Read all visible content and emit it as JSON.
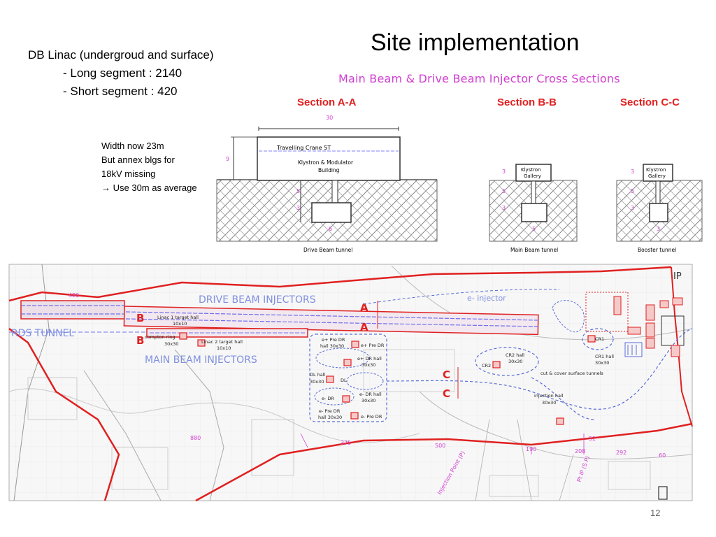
{
  "title": "Site implementation",
  "db_linac": {
    "heading": "DB Linac (undergroud and surface)",
    "long": "- Long segment : 2140",
    "short": "- Short segment :  420"
  },
  "note": {
    "line1": "Width now 23m",
    "line2": "But annex blgs for",
    "line3": "18kV missing",
    "line4": "→ Use 30m as average"
  },
  "cross_section": {
    "title": "Main Beam & Drive Beam Injector Cross Sections",
    "section_a": "Section A-A",
    "section_b": "Section B-B",
    "section_c": "Section C-C",
    "crane": "Travelling Crane 5T",
    "klystron_mod": "Klystron & Modulator",
    "building": "Building",
    "klystron_gallery_1": "Klystron",
    "klystron_gallery_2": "Gallery",
    "width_30": "30",
    "height_9": "9",
    "dim_3": "3",
    "dim_5": "5",
    "dim_6": "6",
    "dim_5b": "5",
    "dim_3b": "3",
    "drive_tunnel": "Drive Beam tunnel",
    "main_tunnel": "Main Beam tunnel",
    "booster_tunnel": "Booster tunnel"
  },
  "map": {
    "drive_beam_injectors": "DRIVE BEAM INJECTORS",
    "main_beam_injectors": "MAIN BEAM INJECTORS",
    "ds_tunnel": "RDS TUNNEL",
    "e_injector": "e- injector",
    "linac1": "Linac 1 target hall",
    "linac1_size": "10x10",
    "linac2": "Linac 2 target hall",
    "linac2_size": "10x10",
    "compton": "compton ring",
    "compton_size": "30x30",
    "pre_dr_hall": "e+ Pre DR",
    "pre_dr_hall_size": "hall 30x30",
    "e_pre_dr": "e+ Pre DR",
    "dr_hall": "e+ DR hall",
    "dr_hall_size": "30x30",
    "dl_hall": "DL hall",
    "dl_size": "30x30",
    "dl_short": "DL",
    "e_dr": "e- DR",
    "e_dr_hall": "e- DR hall",
    "e_dr_hall_size": "30x30",
    "e_pre_dr2": "e- Pre DR",
    "e_pre_dr2_size": "hall 30x30",
    "e_pre_dr3": "e- Pre DR",
    "cr2_hall": "CR2 hall",
    "cr2_size": "30x30",
    "cr2": "CR2",
    "cr1": "CR1",
    "cr1_hall": "CR1 hall",
    "cr1_size": "30x30",
    "cut_cover": "cut & cover surface tunnels",
    "injection_hall": "injection hall",
    "injection_size": "30x30",
    "marker_a": "A",
    "marker_b": "B",
    "marker_c": "C",
    "len_420": "420",
    "len_880": "880",
    "len_375": "375",
    "len_500": "500",
    "len_190": "190",
    "len_208": "208",
    "len_52": "52",
    "len_292": "292",
    "len_60": "60",
    "injection_point": "Injection Point (P)",
    "point_ip": "Pt IP (S P)"
  },
  "page_number": "12",
  "colors": {
    "accent_red": "#e02020",
    "diagram_magenta": "#d040d0",
    "injector_blue": "#5a6cd8"
  }
}
